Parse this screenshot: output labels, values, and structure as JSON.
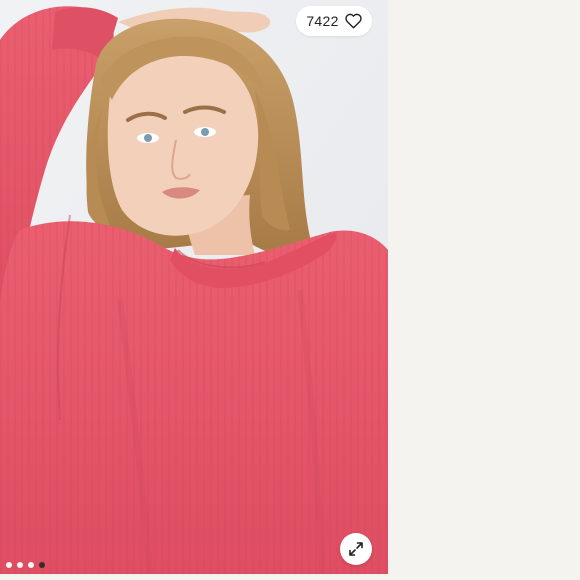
{
  "listing": {
    "like_count": "7422",
    "like_icon": "heart-outline-icon",
    "expand_icon": "expand-arrows-icon",
    "carousel": {
      "total": 4,
      "active_index": 3
    }
  },
  "colors": {
    "sweater": "#e8586a",
    "page_background": "#f4f3ef",
    "photo_background": "#eceef1"
  }
}
